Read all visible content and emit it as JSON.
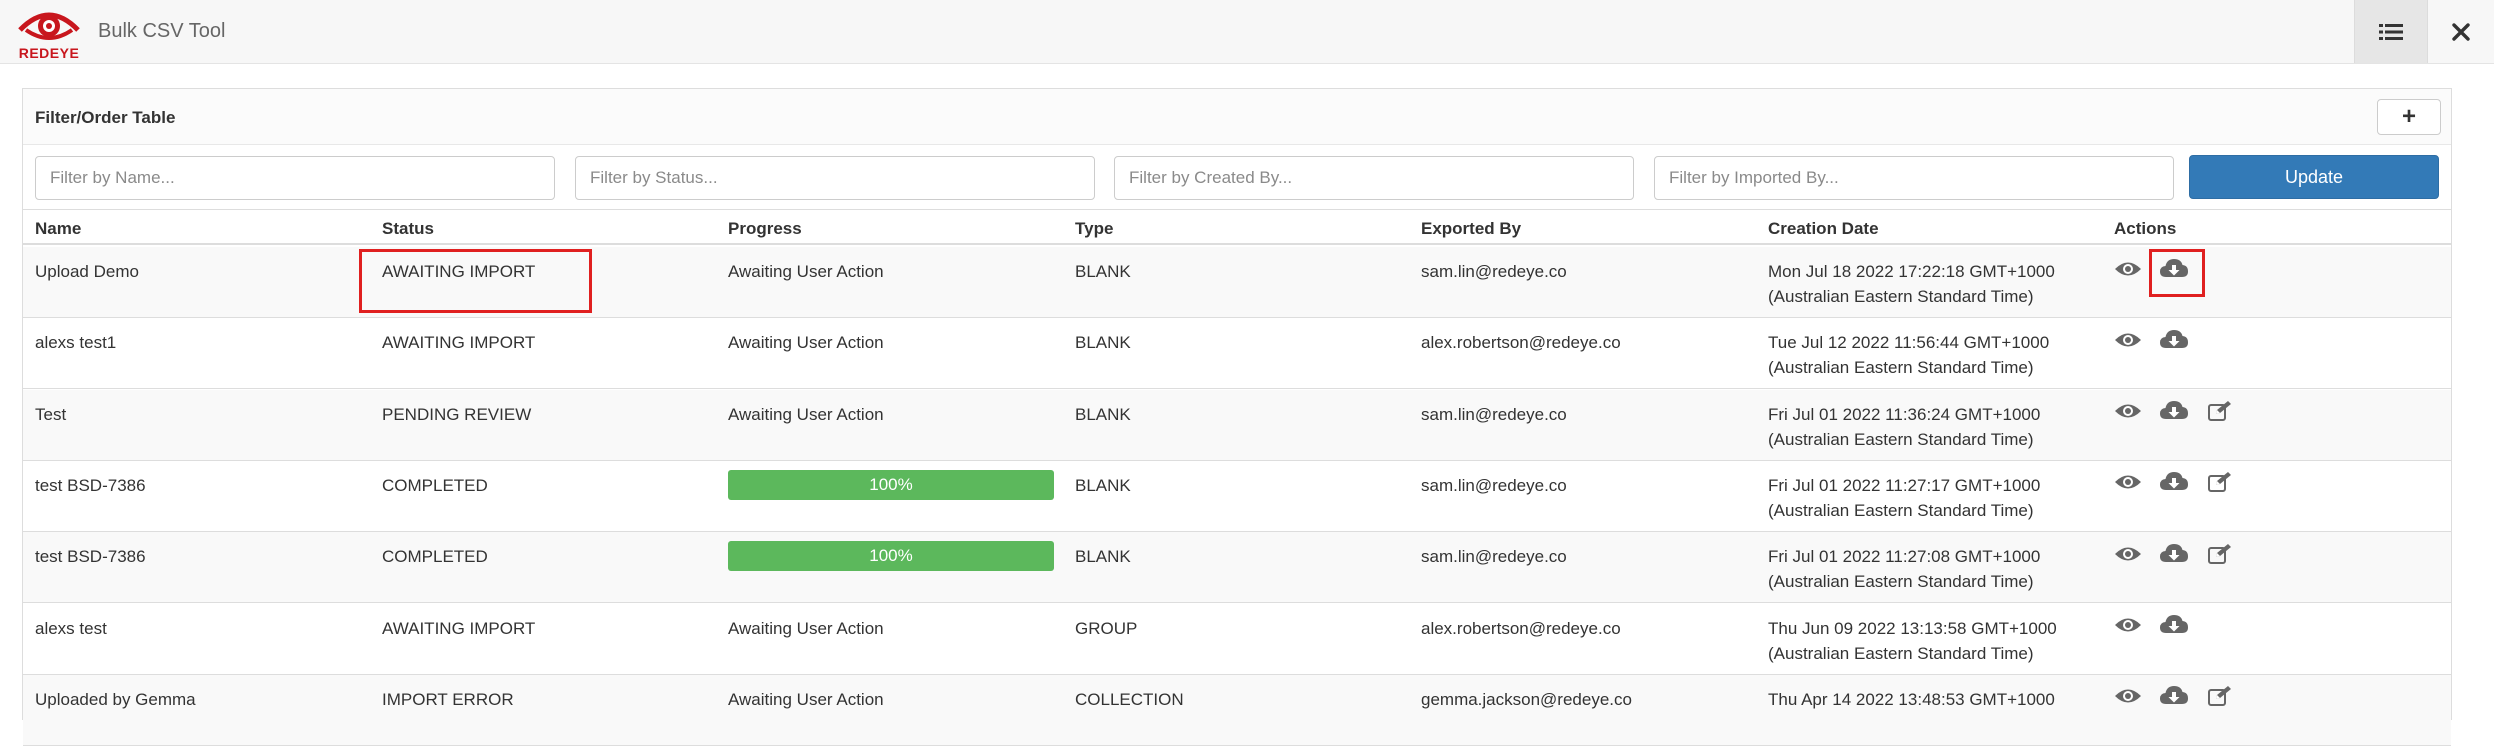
{
  "app": {
    "logo_text": "REDEYE",
    "title": "Bulk CSV Tool"
  },
  "colors": {
    "brand": "#c8161d",
    "primary": "#337ab7",
    "success": "#5cb85c",
    "highlight": "#e02020"
  },
  "panel": {
    "title": "Filter/Order Table",
    "add_label": "+"
  },
  "filters": {
    "name_placeholder": "Filter by Name...",
    "status_placeholder": "Filter by Status...",
    "created_by_placeholder": "Filter by Created By...",
    "imported_by_placeholder": "Filter by Imported By...",
    "update_label": "Update"
  },
  "table": {
    "columns": [
      "Name",
      "Status",
      "Progress",
      "Type",
      "Exported By",
      "Creation Date",
      "Actions"
    ],
    "rows": [
      {
        "name": "Upload Demo",
        "status": "AWAITING IMPORT",
        "progress_text": "Awaiting User Action",
        "progress_percent": null,
        "type": "BLANK",
        "exported_by": "sam.lin@redeye.co",
        "date_line1": "Mon Jul 18 2022 17:22:18 GMT+1000",
        "date_line2": "(Australian Eastern Standard Time)",
        "actions": [
          "eye-icon",
          "download-icon"
        ]
      },
      {
        "name": "alexs test1",
        "status": "AWAITING IMPORT",
        "progress_text": "Awaiting User Action",
        "progress_percent": null,
        "type": "BLANK",
        "exported_by": "alex.robertson@redeye.co",
        "date_line1": "Tue Jul 12 2022 11:56:44 GMT+1000",
        "date_line2": "(Australian Eastern Standard Time)",
        "actions": [
          "eye-icon",
          "download-icon"
        ]
      },
      {
        "name": "Test",
        "status": "PENDING REVIEW",
        "progress_text": "Awaiting User Action",
        "progress_percent": null,
        "type": "BLANK",
        "exported_by": "sam.lin@redeye.co",
        "date_line1": "Fri Jul 01 2022 11:36:24 GMT+1000",
        "date_line2": "(Australian Eastern Standard Time)",
        "actions": [
          "eye-icon",
          "download-icon",
          "edit-icon"
        ]
      },
      {
        "name": "test BSD-7386",
        "status": "COMPLETED",
        "progress_text": "100%",
        "progress_percent": 100,
        "type": "BLANK",
        "exported_by": "sam.lin@redeye.co",
        "date_line1": "Fri Jul 01 2022 11:27:17 GMT+1000",
        "date_line2": "(Australian Eastern Standard Time)",
        "actions": [
          "eye-icon",
          "download-icon",
          "edit-icon"
        ]
      },
      {
        "name": "test BSD-7386",
        "status": "COMPLETED",
        "progress_text": "100%",
        "progress_percent": 100,
        "type": "BLANK",
        "exported_by": "sam.lin@redeye.co",
        "date_line1": "Fri Jul 01 2022 11:27:08 GMT+1000",
        "date_line2": "(Australian Eastern Standard Time)",
        "actions": [
          "eye-icon",
          "download-icon",
          "edit-icon"
        ]
      },
      {
        "name": "alexs test",
        "status": "AWAITING IMPORT",
        "progress_text": "Awaiting User Action",
        "progress_percent": null,
        "type": "GROUP",
        "exported_by": "alex.robertson@redeye.co",
        "date_line1": "Thu Jun 09 2022 13:13:58 GMT+1000",
        "date_line2": "(Australian Eastern Standard Time)",
        "actions": [
          "eye-icon",
          "download-icon"
        ]
      },
      {
        "name": "Uploaded by Gemma",
        "status": "IMPORT ERROR",
        "progress_text": "Awaiting User Action",
        "progress_percent": null,
        "type": "COLLECTION",
        "exported_by": "gemma.jackson@redeye.co",
        "date_line1": "Thu Apr 14 2022 13:48:53 GMT+1000",
        "date_line2": "",
        "actions": [
          "eye-icon",
          "download-icon",
          "edit-icon"
        ]
      }
    ]
  },
  "topbar_icons": [
    "list-icon",
    "close-icon"
  ]
}
